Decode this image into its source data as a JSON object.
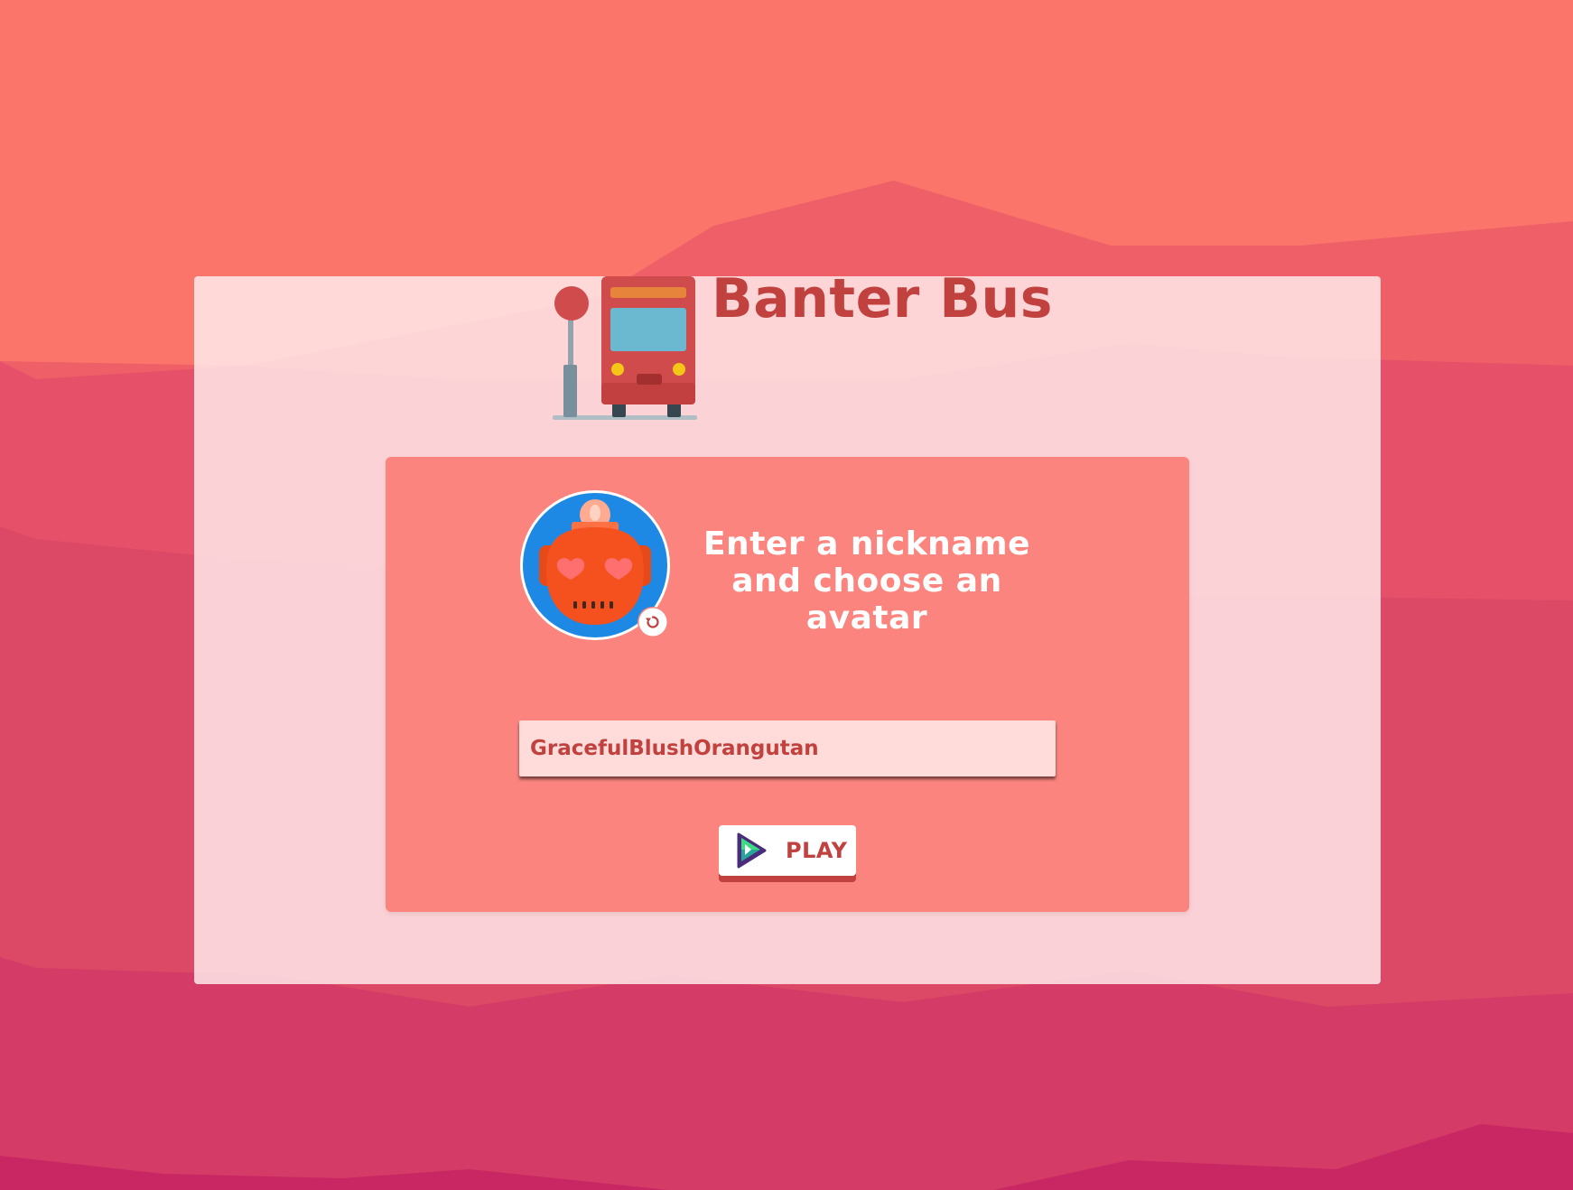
{
  "app": {
    "title": "Banter Bus",
    "logo_icon": "bus-stop-icon"
  },
  "join_form": {
    "prompt": "Enter a nickname and choose an avatar",
    "avatar_icon": "robot-avatar-icon",
    "refresh_icon": "refresh-icon",
    "nickname_value": "GracefulBlushOrangutan",
    "play_label": "PLAY",
    "play_icon": "play-icon"
  },
  "colors": {
    "brand": "#c0413e",
    "panel": "#fb857e",
    "input_bg": "#ffdbd9",
    "avatar_bg": "#1e88e5",
    "robot": "#f4511e"
  }
}
